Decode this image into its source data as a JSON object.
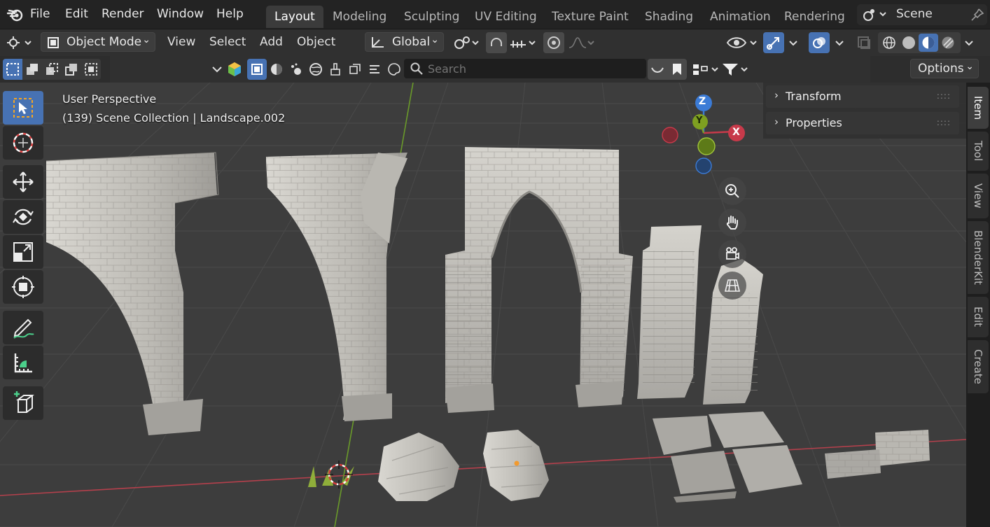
{
  "app": {
    "logo": "blender-logo-icon"
  },
  "menu": {
    "file": "File",
    "edit": "Edit",
    "render": "Render",
    "window": "Window",
    "help": "Help"
  },
  "workspaces": [
    "Layout",
    "Modeling",
    "Sculpting",
    "UV Editing",
    "Texture Paint",
    "Shading",
    "Animation",
    "Rendering"
  ],
  "scene": {
    "label": "Scene"
  },
  "header": {
    "mode": "Object Mode",
    "view": "View",
    "select": "Select",
    "add": "Add",
    "object": "Object",
    "orientation": "Global",
    "options": "Options"
  },
  "search": {
    "placeholder": "Search"
  },
  "viewport": {
    "perspective": "User Perspective",
    "collection": "(139) Scene Collection | Landscape.002"
  },
  "gizmo": {
    "z": "Z",
    "y": "Y",
    "x": "X"
  },
  "npanel": {
    "transform": "Transform",
    "properties": "Properties"
  },
  "side_tabs": [
    "Item",
    "Tool",
    "View",
    "BlenderKit",
    "Edit",
    "Create"
  ],
  "colors": {
    "accent": "#4772b3",
    "x_axis": "#c73a4a",
    "y_axis": "#7ea021",
    "z_axis": "#3b7bd6",
    "bg": "#3d3d3d",
    "stone": "#c8c6c0"
  }
}
